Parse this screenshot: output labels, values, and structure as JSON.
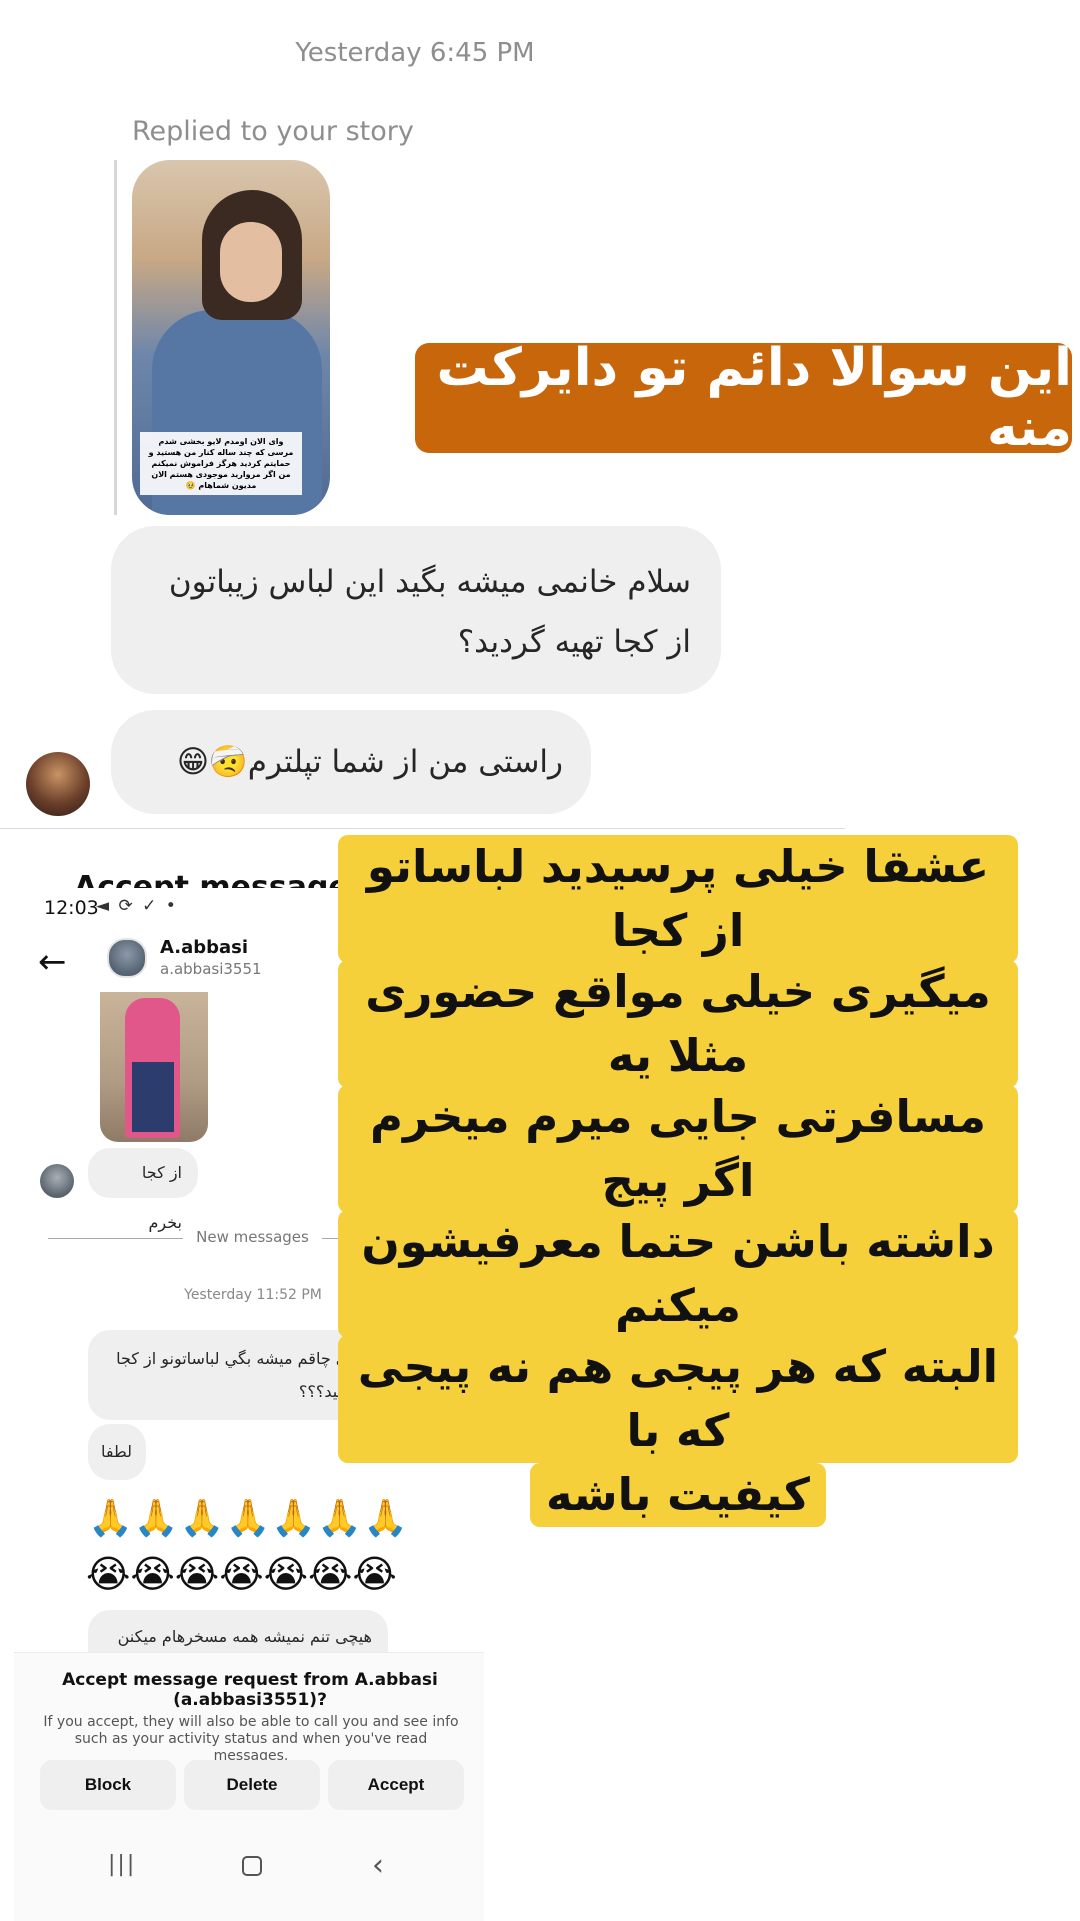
{
  "top_thread": {
    "timestamp": "Yesterday 6:45 PM",
    "replied_label": "Replied to your story",
    "story_caption": "وای الان اومدم لایو بخشی شدم مرسی که چند ساله کنار من هستید و حمایتم کردید هرگز فراموش نمیکنم من اگر مروارید موجودی هستم الان مدیون شماهام 🥹",
    "overlay_banner": "این سوالا دائم تو دایرکت منه",
    "messages": [
      "سلام خانمی میشه بگید این لباس زیباتون از کجا تهیه گردید؟",
      "راستی من از شما تپلترم🤕😁🙈"
    ]
  },
  "bottom_thread": {
    "partial_header": "Accept message re",
    "status_bar": {
      "time": "12:03",
      "icons": "◄ ⟳ ✓ •"
    },
    "header": {
      "name": "A.abbasi",
      "username": "a.abbasi3551"
    },
    "messages_before": [
      "از کجا بخرم"
    ],
    "new_messages_label": "New messages",
    "timestamp": "Yesterday 11:52 PM",
    "messages_after": [
      "من خيلي چاقم ميشه بگي لباساتونو از كجا تهيه ميكنيد؟؟؟",
      "لطفا",
      "🙏🙏🙏🙏🙏🙏🙏",
      "😭😭😭😭😭😭😭",
      "هیچی تنم نمیشه همه مسخرهام میکنن"
    ],
    "overlay_banner_lines": [
      "عشقا خیلی پرسیدید لباساتو از کجا",
      "میگیری خیلی مواقع حضوری مثلا یه",
      "مسافرتی جایی میرم میخرم  اگر پیج",
      "داشته باشن حتما معرفیشون میکنم",
      "البته که هر پیجی هم نه پیجی که با",
      "کیفیت باشه"
    ],
    "accept_request": {
      "title": "Accept message request from A.abbasi (a.abbasi3551)?",
      "description": "If you accept, they will also be able to call you and see info such as your activity status and when you've read messages.",
      "buttons": {
        "block": "Block",
        "delete": "Delete",
        "accept": "Accept"
      }
    },
    "nav_bar": {
      "recent": "|||",
      "back": "‹"
    }
  },
  "colors": {
    "orange_banner": "#c8660c",
    "yellow_banner": "#f5d03b",
    "bubble_gray": "#efefef"
  }
}
